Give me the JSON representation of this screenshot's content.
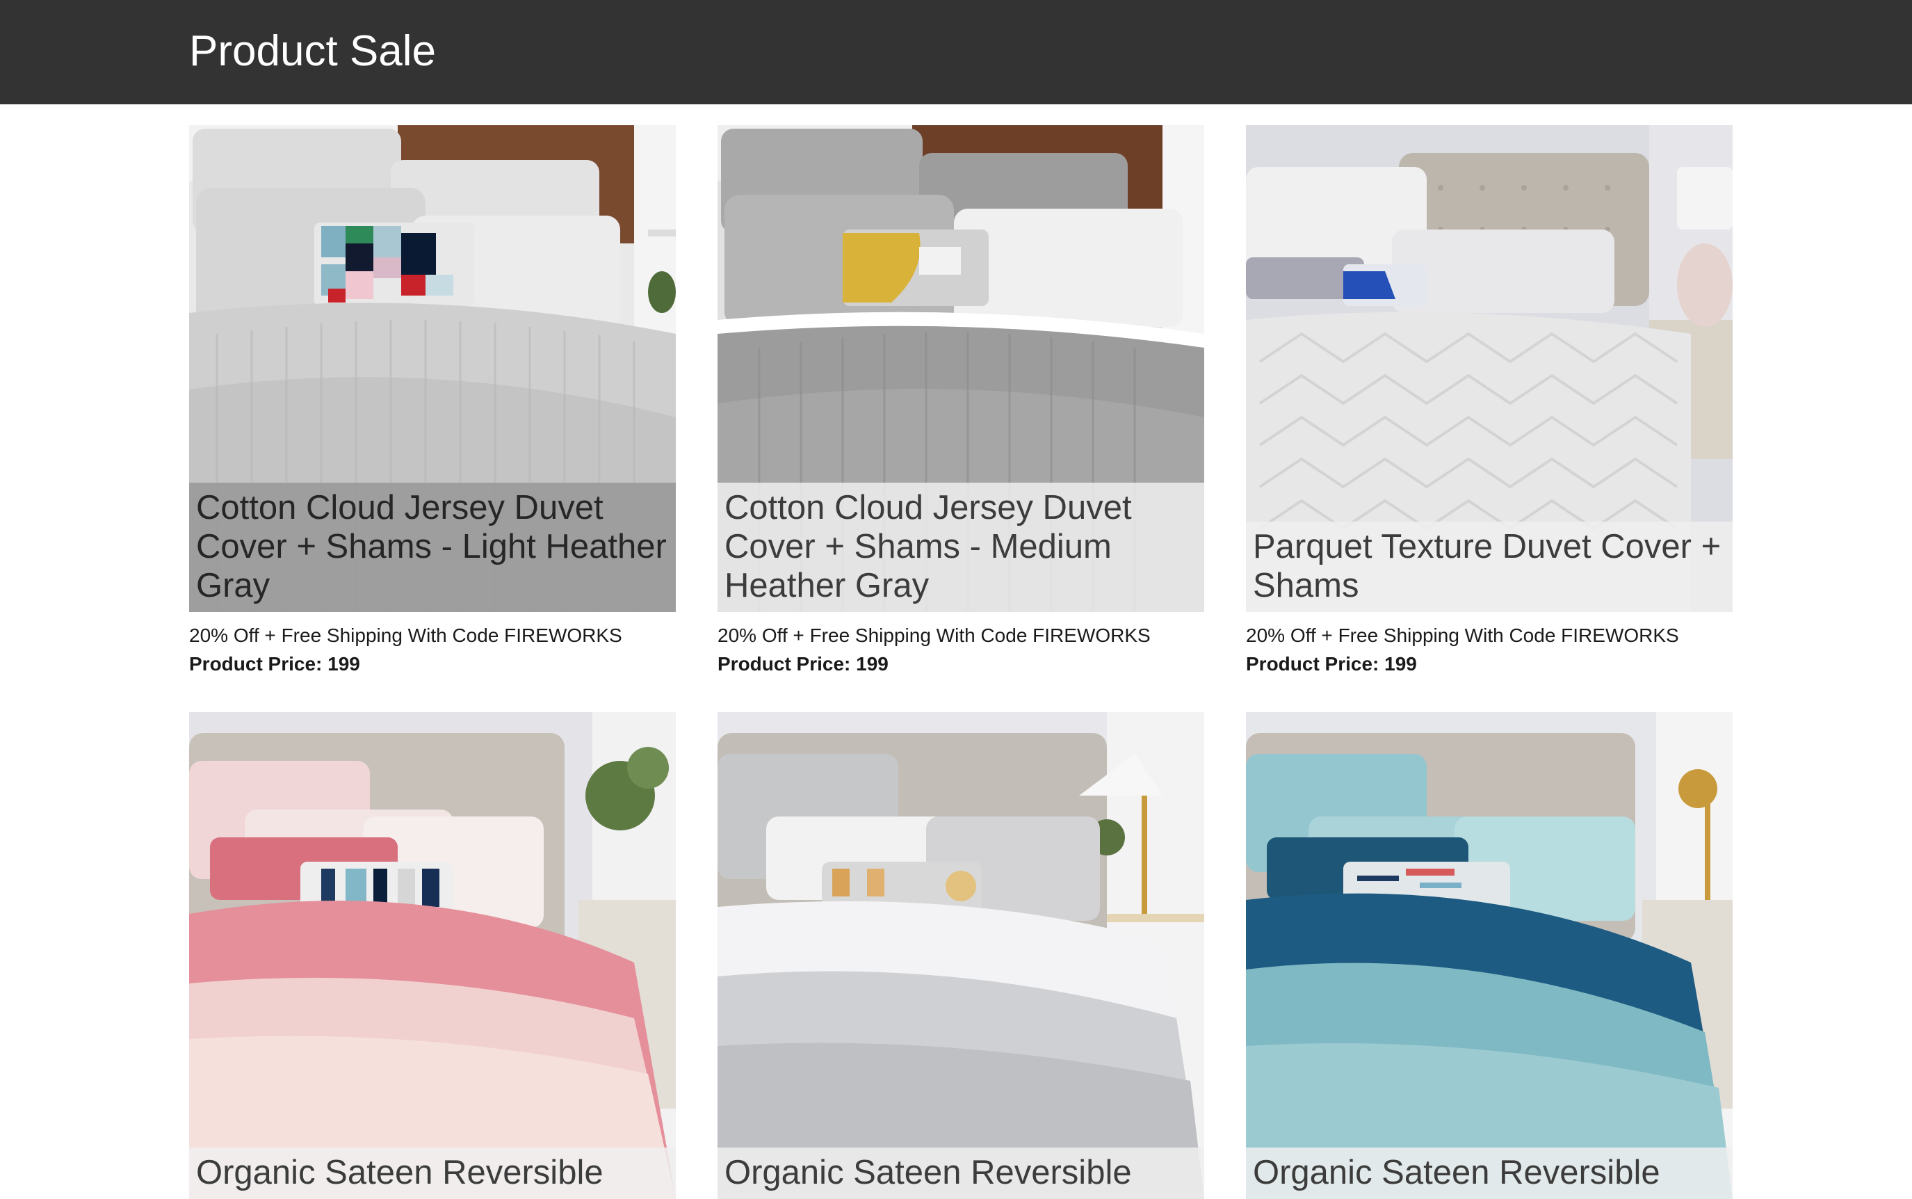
{
  "header": {
    "title": "Product Sale"
  },
  "products": [
    {
      "title": "Cotton Cloud Jersey Duvet Cover + Shams - Light Heather Gray",
      "promo": "20% Off + Free Shipping With Code FIREWORKS",
      "price_label": "Product Price: 199",
      "image_alt": "light heather gray duvet bedding"
    },
    {
      "title": "Cotton Cloud Jersey Duvet Cover + Shams - Medium Heather Gray",
      "promo": "20% Off + Free Shipping With Code FIREWORKS",
      "price_label": "Product Price: 199",
      "image_alt": "medium heather gray duvet bedding"
    },
    {
      "title": "Parquet Texture Duvet Cover + Shams",
      "promo": "20% Off + Free Shipping With Code FIREWORKS",
      "price_label": "Product Price: 199",
      "image_alt": "white parquet texture duvet bedding"
    },
    {
      "title": "Organic Sateen Reversible",
      "image_alt": "pink organic sateen bedding"
    },
    {
      "title": "Organic Sateen Reversible",
      "image_alt": "gray organic sateen bedding"
    },
    {
      "title": "Organic Sateen Reversible",
      "image_alt": "blue organic sateen bedding"
    }
  ],
  "colors": {
    "header_bg": "#333333",
    "header_text": "#ffffff"
  }
}
